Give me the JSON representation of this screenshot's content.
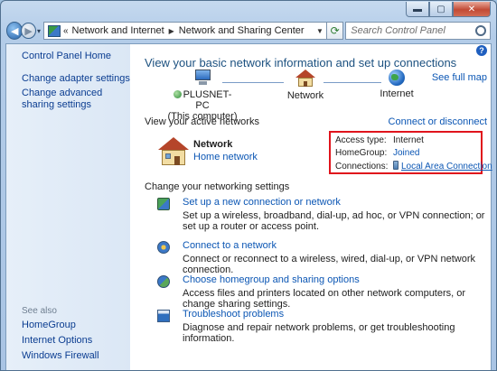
{
  "window": {
    "caption_buttons": {
      "minimize": "▬",
      "maximize": "▢",
      "close": "✕"
    }
  },
  "nav": {
    "history_glyph": "▾",
    "breadcrumb": [
      "Network and Internet",
      "Network and Sharing Center"
    ],
    "crumb_overflow": "«",
    "search_placeholder": "Search Control Panel"
  },
  "sidebar": {
    "home": "Control Panel Home",
    "links": [
      "Change adapter settings",
      "Change advanced sharing settings"
    ],
    "see_also_label": "See also",
    "see_also": [
      "HomeGroup",
      "Internet Options",
      "Windows Firewall"
    ]
  },
  "main": {
    "title": "View your basic network information and set up connections",
    "see_full_map": "See full map",
    "map": {
      "computer": [
        "PLUSNET-PC",
        "(This computer)"
      ],
      "network": "Network",
      "internet": "Internet"
    },
    "active_networks_label": "View your active networks",
    "connect_disconnect": "Connect or disconnect",
    "active_network": {
      "name": "Network",
      "type": "Home network"
    },
    "details": {
      "access_type_label": "Access type:",
      "access_type_value": "Internet",
      "homegroup_label": "HomeGroup:",
      "homegroup_value": "Joined",
      "connections_label": "Connections:",
      "connections_value": "Local Area Connection"
    },
    "change_settings_label": "Change your networking settings",
    "tasks": [
      {
        "icon": "new-connection-icon",
        "title": "Set up a new connection or network",
        "description": "Set up a wireless, broadband, dial-up, ad hoc, or VPN connection; or set up a router or access point."
      },
      {
        "icon": "connect-network-icon",
        "title": "Connect to a network",
        "description": "Connect or reconnect to a wireless, wired, dial-up, or VPN network connection."
      },
      {
        "icon": "homegroup-icon",
        "title": "Choose homegroup and sharing options",
        "description": "Access files and printers located on other network computers, or change sharing settings."
      },
      {
        "icon": "troubleshoot-icon",
        "title": "Troubleshoot problems",
        "description": "Diagnose and repair network problems, or get troubleshooting information."
      }
    ]
  }
}
